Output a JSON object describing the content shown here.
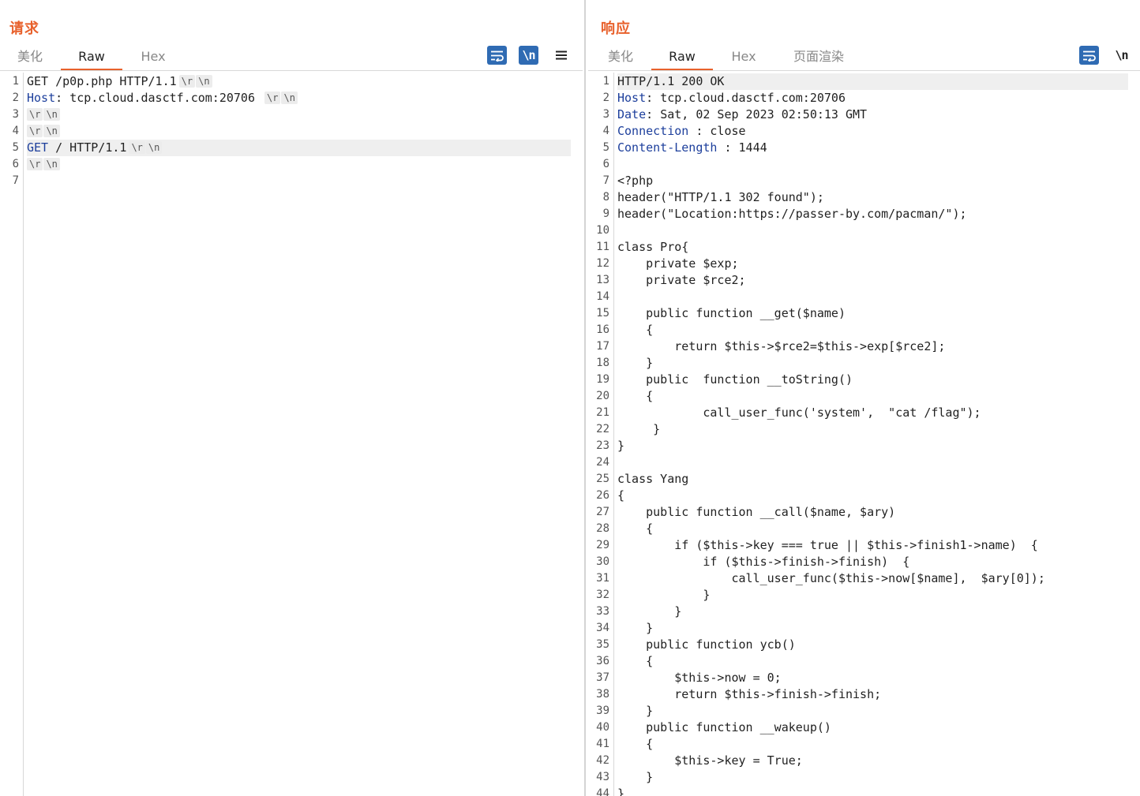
{
  "request": {
    "title": "请求",
    "tabs": [
      {
        "label": "美化"
      },
      {
        "label": "Raw"
      },
      {
        "label": "Hex"
      }
    ],
    "active_tab": "Raw",
    "toolbar": {
      "wrap_icon": "wrap-lines-icon",
      "newline_label": "\\n",
      "menu_icon": "hamburger-menu-icon"
    },
    "lines": [
      {
        "num": "1",
        "name": "",
        "sep": "",
        "text": "GET /p0p.php HTTP/1.1",
        "crlf": true
      },
      {
        "num": "2",
        "name": "Host",
        "sep": ": ",
        "text": "tcp.cloud.dasctf.com:20706 ",
        "crlf": true
      },
      {
        "num": "3",
        "name": "",
        "sep": "",
        "text": "",
        "crlf": true
      },
      {
        "num": "4",
        "name": "",
        "sep": "",
        "text": "",
        "crlf": true
      },
      {
        "num": "5",
        "name": "GET",
        "sep": " ",
        "text": "/ HTTP/1.1",
        "crlf": true,
        "highlight": true
      },
      {
        "num": "6",
        "name": "",
        "sep": "",
        "text": "",
        "crlf": true
      },
      {
        "num": "7",
        "name": "",
        "sep": "",
        "text": "",
        "crlf": false
      }
    ],
    "crlf_r": "\\r",
    "crlf_n": "\\n"
  },
  "response": {
    "title": "响应",
    "tabs": [
      {
        "label": "美化"
      },
      {
        "label": "Raw"
      },
      {
        "label": "Hex"
      },
      {
        "label": "页面渲染"
      }
    ],
    "active_tab": "Raw",
    "toolbar": {
      "wrap_icon": "wrap-lines-icon",
      "newline_label": "\\n"
    },
    "lines": [
      {
        "num": "1",
        "name": "",
        "sep": "",
        "text": "HTTP/1.1 200 OK",
        "highlight": true
      },
      {
        "num": "2",
        "name": "Host",
        "sep": ": ",
        "text": "tcp.cloud.dasctf.com:20706"
      },
      {
        "num": "3",
        "name": "Date",
        "sep": ": ",
        "text": "Sat, 02 Sep 2023 02:50:13 GMT"
      },
      {
        "num": "4",
        "name": "Connection",
        "sep": " : ",
        "text": "close"
      },
      {
        "num": "5",
        "name": "Content-Length",
        "sep": " : ",
        "text": "1444"
      },
      {
        "num": "6",
        "name": "",
        "sep": "",
        "text": ""
      },
      {
        "num": "7",
        "name": "",
        "sep": "",
        "text": "<?php"
      },
      {
        "num": "8",
        "name": "",
        "sep": "",
        "text": "header(\"HTTP/1.1 302 found\");"
      },
      {
        "num": "9",
        "name": "",
        "sep": "",
        "text": "header(\"Location:https://passer-by.com/pacman/\");"
      },
      {
        "num": "10",
        "name": "",
        "sep": "",
        "text": ""
      },
      {
        "num": "11",
        "name": "",
        "sep": "",
        "text": "class Pro{"
      },
      {
        "num": "12",
        "name": "",
        "sep": "",
        "text": "    private $exp;"
      },
      {
        "num": "13",
        "name": "",
        "sep": "",
        "text": "    private $rce2;"
      },
      {
        "num": "14",
        "name": "",
        "sep": "",
        "text": ""
      },
      {
        "num": "15",
        "name": "",
        "sep": "",
        "text": "    public function __get($name)"
      },
      {
        "num": "16",
        "name": "",
        "sep": "",
        "text": "    {"
      },
      {
        "num": "17",
        "name": "",
        "sep": "",
        "text": "        return $this->$rce2=$this->exp[$rce2];"
      },
      {
        "num": "18",
        "name": "",
        "sep": "",
        "text": "    }"
      },
      {
        "num": "19",
        "name": "",
        "sep": "",
        "text": "    public  function __toString()"
      },
      {
        "num": "20",
        "name": "",
        "sep": "",
        "text": "    {"
      },
      {
        "num": "21",
        "name": "",
        "sep": "",
        "text": "            call_user_func('system',  \"cat /flag\");"
      },
      {
        "num": "22",
        "name": "",
        "sep": "",
        "text": "     }"
      },
      {
        "num": "23",
        "name": "",
        "sep": "",
        "text": "}"
      },
      {
        "num": "24",
        "name": "",
        "sep": "",
        "text": ""
      },
      {
        "num": "25",
        "name": "",
        "sep": "",
        "text": "class Yang"
      },
      {
        "num": "26",
        "name": "",
        "sep": "",
        "text": "{"
      },
      {
        "num": "27",
        "name": "",
        "sep": "",
        "text": "    public function __call($name, $ary)"
      },
      {
        "num": "28",
        "name": "",
        "sep": "",
        "text": "    {"
      },
      {
        "num": "29",
        "name": "",
        "sep": "",
        "text": "        if ($this->key === true || $this->finish1->name)  {"
      },
      {
        "num": "30",
        "name": "",
        "sep": "",
        "text": "            if ($this->finish->finish)  {"
      },
      {
        "num": "31",
        "name": "",
        "sep": "",
        "text": "                call_user_func($this->now[$name],  $ary[0]);"
      },
      {
        "num": "32",
        "name": "",
        "sep": "",
        "text": "            }"
      },
      {
        "num": "33",
        "name": "",
        "sep": "",
        "text": "        }"
      },
      {
        "num": "34",
        "name": "",
        "sep": "",
        "text": "    }"
      },
      {
        "num": "35",
        "name": "",
        "sep": "",
        "text": "    public function ycb()"
      },
      {
        "num": "36",
        "name": "",
        "sep": "",
        "text": "    {"
      },
      {
        "num": "37",
        "name": "",
        "sep": "",
        "text": "        $this->now = 0;"
      },
      {
        "num": "38",
        "name": "",
        "sep": "",
        "text": "        return $this->finish->finish;"
      },
      {
        "num": "39",
        "name": "",
        "sep": "",
        "text": "    }"
      },
      {
        "num": "40",
        "name": "",
        "sep": "",
        "text": "    public function __wakeup()"
      },
      {
        "num": "41",
        "name": "",
        "sep": "",
        "text": "    {"
      },
      {
        "num": "42",
        "name": "",
        "sep": "",
        "text": "        $this->key = True;"
      },
      {
        "num": "43",
        "name": "",
        "sep": "",
        "text": "    }"
      },
      {
        "num": "44",
        "name": "",
        "sep": "",
        "text": "}"
      }
    ]
  },
  "layout_toggle": {
    "active": "side-by-side",
    "icons": [
      "columns-layout-icon",
      "rows-layout-icon"
    ]
  },
  "colors": {
    "accent": "#e8612c",
    "button": "#2f6bb3",
    "header_name": "#1d3f9c"
  }
}
